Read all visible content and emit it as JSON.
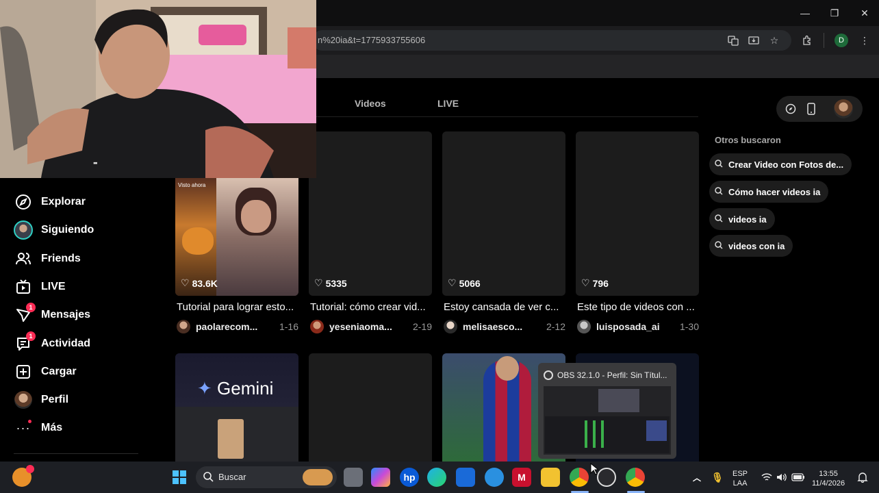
{
  "browser": {
    "url_fragment": "n%20ia&t=1775933755606",
    "window_controls": {
      "minimize": "—",
      "maximize": "❐",
      "close": "✕"
    },
    "profile_initial": "D"
  },
  "tabs": [
    {
      "label": "Videos"
    },
    {
      "label": "LIVE"
    }
  ],
  "sidebar": {
    "items": [
      {
        "label": "Explorar",
        "icon": "compass-icon"
      },
      {
        "label": "Siguiendo",
        "icon": "following-avatar-icon"
      },
      {
        "label": "Friends",
        "icon": "friends-icon"
      },
      {
        "label": "LIVE",
        "icon": "live-tv-icon"
      },
      {
        "label": "Mensajes",
        "icon": "messages-icon",
        "badge": "1"
      },
      {
        "label": "Actividad",
        "icon": "activity-icon",
        "badge": "1"
      },
      {
        "label": "Cargar",
        "icon": "upload-plus-icon"
      },
      {
        "label": "Perfil",
        "icon": "profile-avatar-icon"
      },
      {
        "label": "Más",
        "icon": "more-dots-icon"
      }
    ]
  },
  "videos": [
    {
      "likes": "83.6K",
      "title": "Tutorial para lograr esto...",
      "author": "paolarecom...",
      "date": "1-16"
    },
    {
      "likes": "5335",
      "title": "Tutorial: cómo crear vid...",
      "author": "yeseniaoma...",
      "date": "2-19"
    },
    {
      "likes": "5066",
      "title": "Estoy cansada de ver c...",
      "author": "melisaesco...",
      "date": "2-12"
    },
    {
      "likes": "796",
      "title": "Este tipo de videos con ...",
      "author": "luisposada_ai",
      "date": "1-30"
    }
  ],
  "thumb_overlays": {
    "gemini": "Gemini",
    "first_thumb_tag": "Visto ahora"
  },
  "related": {
    "title": "Otros buscaron",
    "items": [
      "Crear Video con Fotos de...",
      "Cómo hacer videos ia",
      "videos ia",
      "videos con ia"
    ]
  },
  "obs_preview": {
    "title": "OBS 32.1.0 - Perfil: Sin Títul..."
  },
  "taskbar": {
    "search_placeholder": "Buscar",
    "language": "ESP",
    "language_sub": "LAA",
    "time": "13:55",
    "date": "11/4/2026"
  },
  "colors": {
    "accent": "#fe2c55",
    "background": "#000000",
    "card": "#1c1c1c",
    "chip": "#1d1d1d"
  }
}
